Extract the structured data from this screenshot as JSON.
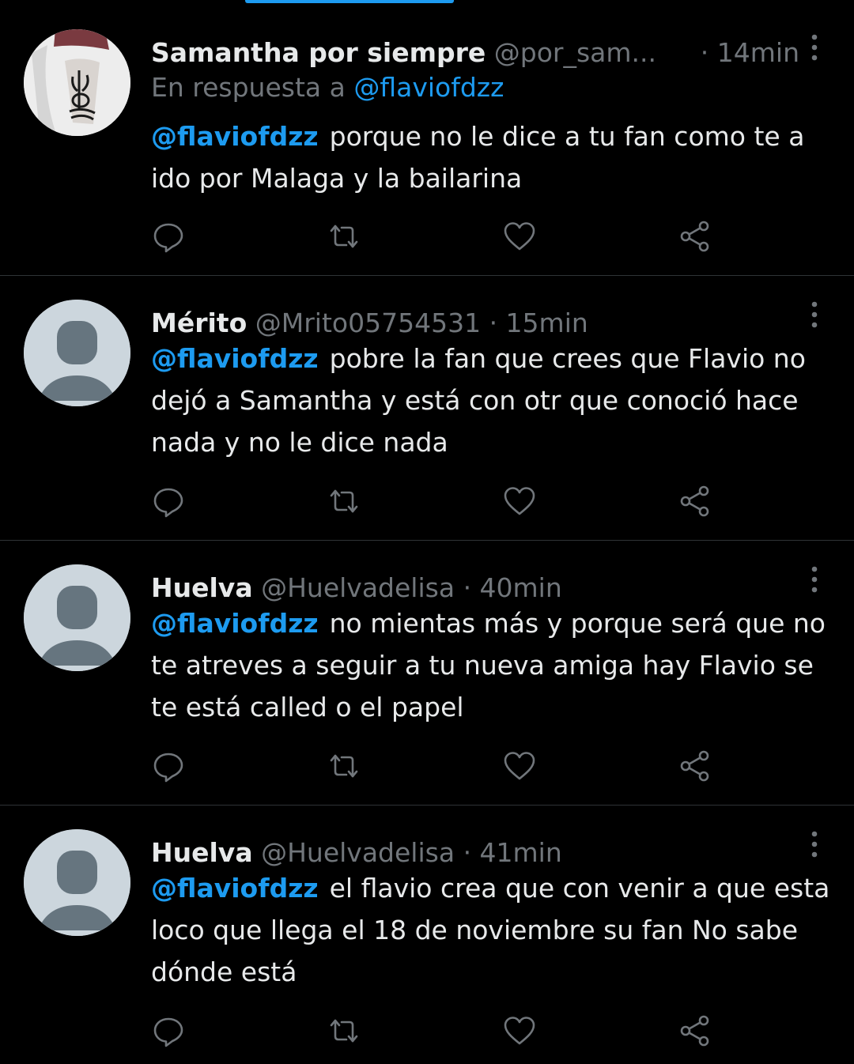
{
  "colors": {
    "background": "#000000",
    "text": "#e7e9ea",
    "muted": "#71767b",
    "accent": "#1d9bf0",
    "divider": "#2f3336"
  },
  "tweets": [
    {
      "name": "Samantha por siempre",
      "handle": "@por_sam...",
      "time": "· 14min",
      "reply_prefix": "En respuesta a",
      "reply_handle": "@flaviofdzz",
      "mention": "@flaviofdzz",
      "text": "porque no le dice a tu fan como te a ido por Malaga y la bailarina",
      "avatar": "photo-avatar"
    },
    {
      "name": "Mérito",
      "handle": "@Mrito05754531",
      "time": "· 15min",
      "mention": "@flaviofdzz",
      "text": "pobre la fan que crees que Flavio no dejó a Samantha y está con otr que conoció hace nada y no le dice nada",
      "avatar": "default-avatar"
    },
    {
      "name": "Huelva",
      "handle": "@Huelvadelisa",
      "time": "· 40min",
      "mention": "@flaviofdzz",
      "text": "no mientas más y porque será que no te atreves a seguir a tu nueva amiga  hay Flavio se te está called o el papel",
      "avatar": "default-avatar"
    },
    {
      "name": "Huelva",
      "handle": "@Huelvadelisa",
      "time": "· 41min",
      "mention": "@flaviofdzz",
      "text": "el flavio crea que con venir a que esta loco que llega el  18 de noviembre su fan No sabe dónde está",
      "avatar": "default-avatar"
    }
  ],
  "icons": {
    "reply": "reply-icon",
    "retweet": "retweet-icon",
    "like": "like-icon",
    "share": "share-icon",
    "more": "more-icon"
  }
}
